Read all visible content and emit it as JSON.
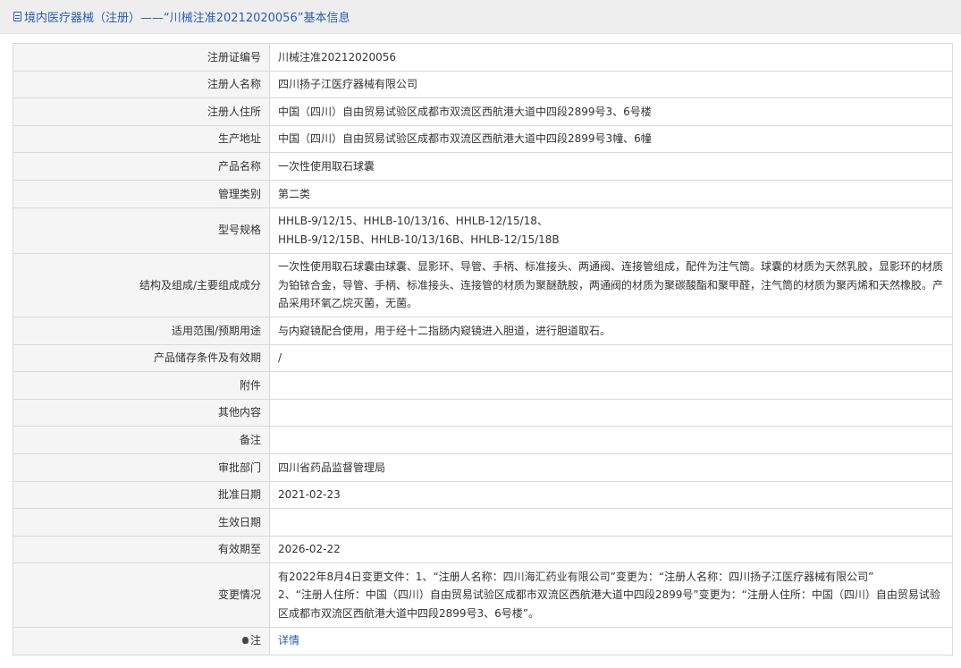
{
  "header": {
    "title": "境内医疗器械（注册）——“川械注准20212020056”基本信息"
  },
  "rows": [
    {
      "label": "注册证编号",
      "value": "川械注准20212020056"
    },
    {
      "label": "注册人名称",
      "value": "四川扬子江医疗器械有限公司"
    },
    {
      "label": "注册人住所",
      "value": "中国（四川）自由贸易试验区成都市双流区西航港大道中四段2899号3、6号楼"
    },
    {
      "label": "生产地址",
      "value": "中国（四川）自由贸易试验区成都市双流区西航港大道中四段2899号3幢、6幢"
    },
    {
      "label": "产品名称",
      "value": "一次性使用取石球囊"
    },
    {
      "label": "管理类别",
      "value": "第二类"
    },
    {
      "label": "型号规格",
      "value_lines": [
        "HHLB-9/12/15、HHLB-10/13/16、HHLB-12/15/18、",
        "HHLB-9/12/15B、HHLB-10/13/16B、HHLB-12/15/18B"
      ]
    },
    {
      "label": "结构及组成/主要组成成分",
      "value": "一次性使用取石球囊由球囊、显影环、导管、手柄、标准接头、两通阀、连接管组成，配件为注气筒。球囊的材质为天然乳胶，显影环的材质为铂铱合金，导管、手柄、标准接头、连接管的材质为聚醚酰胺，两通阀的材质为聚碳酸酯和聚甲醛，注气筒的材质为聚丙烯和天然橡胶。产品采用环氧乙烷灭菌，无菌。"
    },
    {
      "label": "适用范围/预期用途",
      "value": "与内窥镜配合使用，用于经十二指肠内窥镜进入胆道，进行胆道取石。"
    },
    {
      "label": "产品储存条件及有效期",
      "value": "/"
    },
    {
      "label": "附件",
      "value": ""
    },
    {
      "label": "其他内容",
      "value": ""
    },
    {
      "label": "备注",
      "value": ""
    },
    {
      "label": "审批部门",
      "value": "四川省药品监督管理局"
    },
    {
      "label": "批准日期",
      "value": "2021-02-23"
    },
    {
      "label": "生效日期",
      "value": ""
    },
    {
      "label": "有效期至",
      "value": "2026-02-22"
    },
    {
      "label": "变更情况",
      "value_lines": [
        "有2022年8月4日变更文件：1、“注册人名称：四川海汇药业有限公司”变更为：“注册人名称：四川扬子江医疗器械有限公司”",
        "2、“注册人住所：中国（四川）自由贸易试验区成都市双流区西航港大道中四段2899号”变更为：“注册人住所：中国（四川）自由贸易试验区成都市双流区西航港大道中四段2899号3、6号楼”。"
      ]
    },
    {
      "label": "注",
      "value": "详情"
    }
  ],
  "colors": {
    "link": "#2a5db0",
    "label_bg": "#f5f5f5",
    "border": "#d9d9d9"
  },
  "icons": {
    "header": "document-icon",
    "note": "lightbulb-icon"
  }
}
